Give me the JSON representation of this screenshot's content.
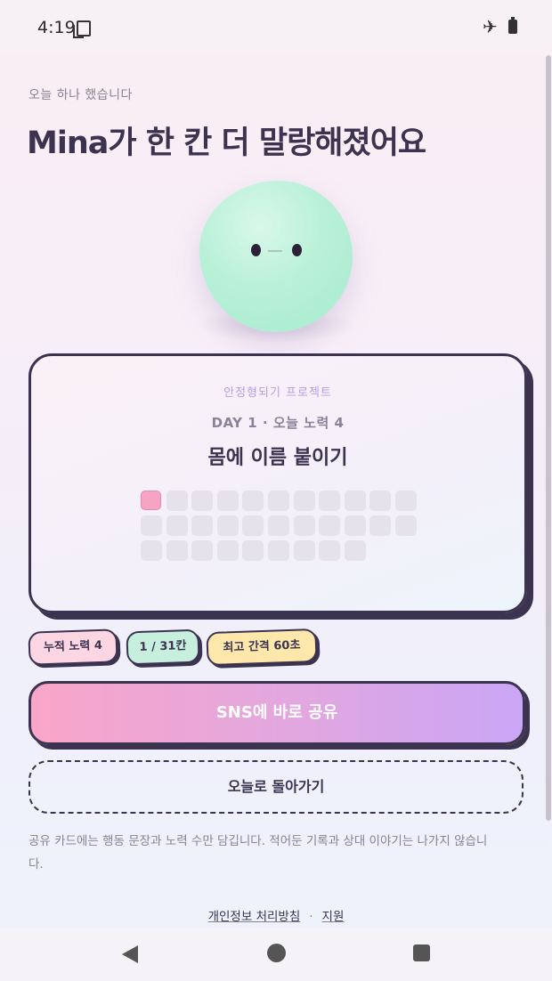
{
  "status": {
    "time": "4:19"
  },
  "header": {
    "eyebrow": "오늘 하나 했습니다",
    "title": "Mina가 한 칸 더 말랑해졌어요"
  },
  "card": {
    "project": "안정형되기 프로젝트",
    "day_line": "DAY 1 · 오늘 노력 4",
    "task": "몸에 이름 붙이기",
    "progress": {
      "filled": 1,
      "total": 31
    }
  },
  "chips": {
    "effort": "누적 노력 4",
    "cells": "1 / 31칸",
    "interval": "최고 간격 60초"
  },
  "actions": {
    "share_label": "SNS에 바로 공유",
    "back_label": "오늘로 돌아가기"
  },
  "notice": "공유 카드에는 행동 문장과 노력 수만 담깁니다. 적어둔 기록과 상대 이야기는 나가지 않습니다.",
  "footer": {
    "privacy": "개인정보 처리방침",
    "separator": "·",
    "support": "지원"
  },
  "colors": {
    "ink": "#3b3350",
    "accent_pink": "#f9a6c8",
    "accent_purple": "#c9a6f6",
    "mint": "#b9f0d8"
  },
  "icons": [
    "copy-icon",
    "airplane-icon",
    "battery-icon",
    "nav-back-icon",
    "nav-home-icon",
    "nav-recent-icon"
  ]
}
